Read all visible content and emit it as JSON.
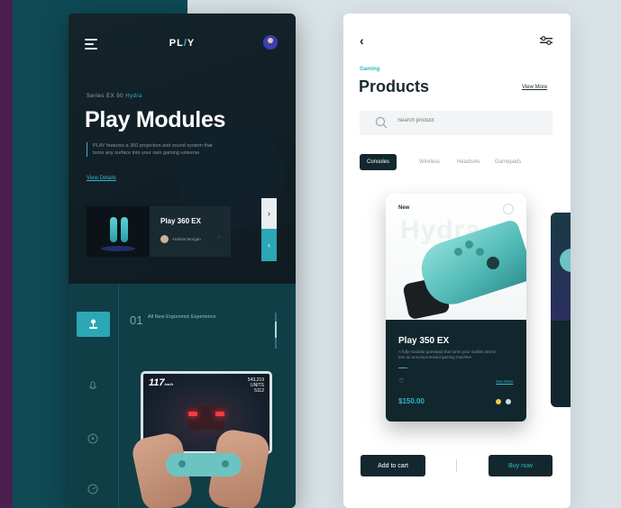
{
  "left": {
    "brand": "PL",
    "brand_accent": "/",
    "brand_end": "Y",
    "series_prefix": "Series EX 50 ",
    "series_accent": "Hydra",
    "title": "Play Modules",
    "description": "PLAY features a 360 projection and sound system that turns any surface into your own gaming universe",
    "view_details": "View Details",
    "card": {
      "name": "Play 360 EX",
      "author": "Andrew Morgan"
    },
    "feature": {
      "number": "01",
      "text": "All New Ergonomic Experience"
    },
    "hud": {
      "speed": "117",
      "speed_unit": "km/h",
      "stat_1": "543,219",
      "stat_2": "UNITS",
      "stat_3": "5112"
    }
  },
  "right": {
    "kicker": "Gaming",
    "title": "Products",
    "view_more": "View More",
    "search_placeholder": "Search product",
    "tabs": [
      "Consoles",
      "Wireless",
      "Headsets",
      "Gamepads"
    ],
    "card": {
      "tag": "New",
      "watermark": "Hydra",
      "name": "Play 350 EX",
      "description": "A fully modular gamepad that turns your mobile device into an uncompromised gaming machine",
      "see_more": "See More",
      "price": "$150.00"
    },
    "add_to_cart": "Add to cart",
    "buy_now": "Buy now"
  },
  "colors": {
    "accent": "#2fb8c7",
    "dark": "#13272e",
    "teal": "#0f4a55",
    "purple": "#4b1f4f"
  },
  "icons": [
    "menu-icon",
    "profile-icon",
    "chevron-right-icon",
    "chevron-left-icon",
    "joystick-icon",
    "mic-icon",
    "compass-icon",
    "gauge-icon",
    "back-arrow-icon",
    "filter-icon",
    "search-icon",
    "heart-icon"
  ]
}
